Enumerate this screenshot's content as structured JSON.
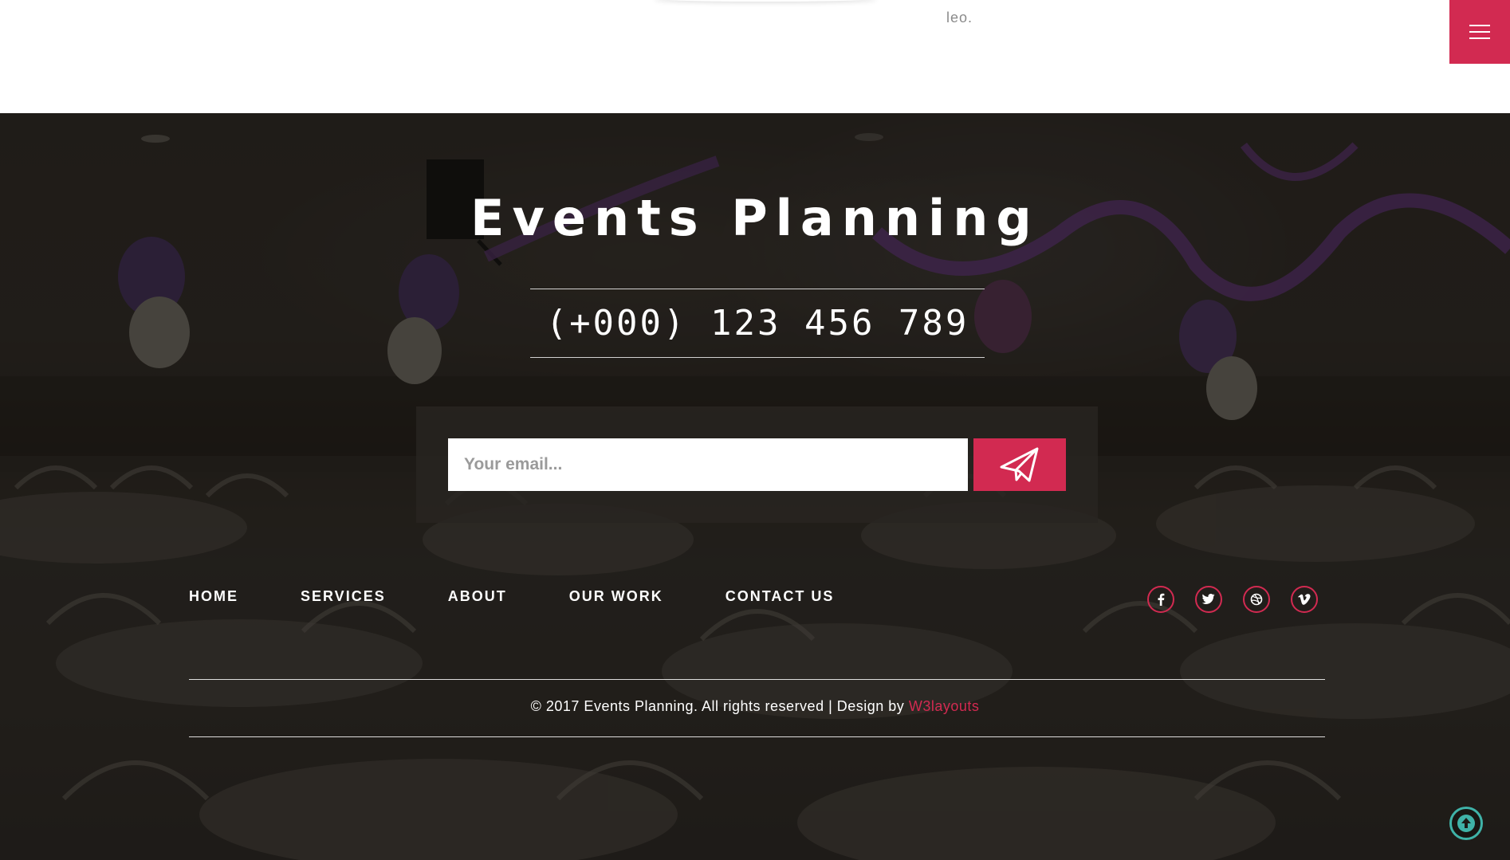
{
  "top": {
    "trailing_text": "leo."
  },
  "menu": {
    "icon": "hamburger-menu-icon"
  },
  "footer": {
    "brand": "Events Planning",
    "phone": "(+000) 123 456 789",
    "newsletter": {
      "placeholder": "Your email...",
      "submit_icon": "paper-plane-icon"
    },
    "nav": [
      "HOME",
      "SERVICES",
      "ABOUT",
      "OUR WORK",
      "CONTACT US"
    ],
    "social": [
      "facebook-icon",
      "twitter-icon",
      "dribbble-icon",
      "vimeo-icon"
    ],
    "copyright_text": "© 2017 Events Planning. All rights reserved | Design by",
    "copyright_link": "W3layouts",
    "back_to_top_icon": "arrow-up-icon"
  },
  "colors": {
    "accent": "#d22a51",
    "scroll_top": "#3fb2a8"
  }
}
